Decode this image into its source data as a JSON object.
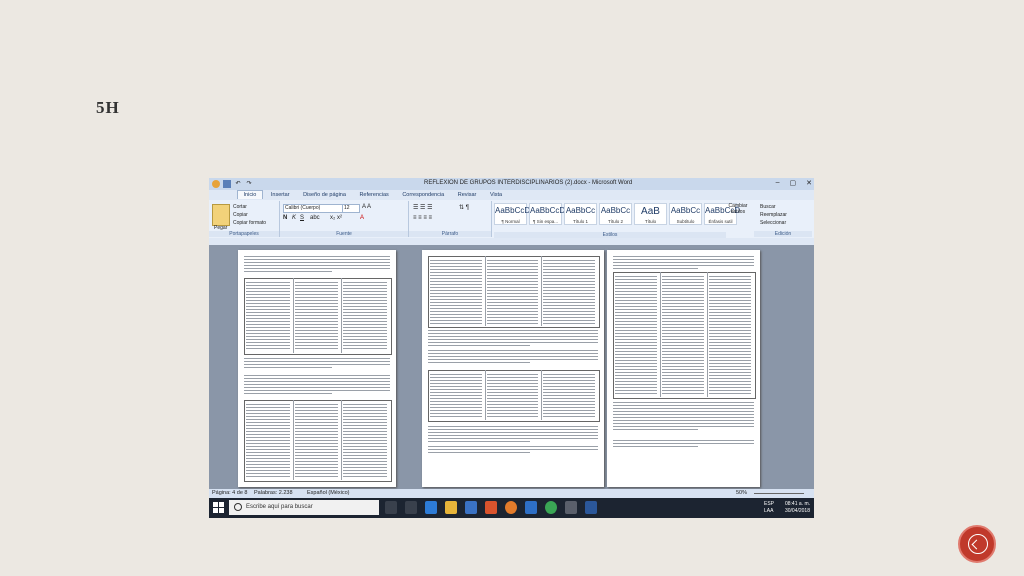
{
  "slide": {
    "title": "5H"
  },
  "window": {
    "title": "REFLEXION DE GRUPOS INTERDISCIPLINARIOS (2).docx - Microsoft Word",
    "min": "–",
    "max": "▢",
    "close": "✕"
  },
  "tabs": [
    "Inicio",
    "Insertar",
    "Diseño de página",
    "Referencias",
    "Correspondencia",
    "Revisar",
    "Vista"
  ],
  "ribbon": {
    "paste": "Pegar",
    "cut": "Cortar",
    "copy": "Copiar",
    "format_painter": "Copiar formato",
    "font_name": "Calibri (Cuerpo)",
    "font_size": "12",
    "clipboard_label": "Portapapeles",
    "font_label": "Fuente",
    "paragraph_label": "Párrafo",
    "styles_label": "Estilos",
    "editing_label": "Edición",
    "change_styles": "Cambiar estilos",
    "find": "Buscar",
    "replace": "Reemplazar",
    "select": "Seleccionar",
    "styles": [
      {
        "sample": "AaBbCcDc",
        "name": "¶ Normal"
      },
      {
        "sample": "AaBbCcDc",
        "name": "¶ Sin espa..."
      },
      {
        "sample": "AaBbCc",
        "name": "Título 1"
      },
      {
        "sample": "AaBbCc",
        "name": "Título 2"
      },
      {
        "sample": "AaB",
        "name": "Título"
      },
      {
        "sample": "AaBbCc",
        "name": "Subtítulo"
      },
      {
        "sample": "AaBbCcD",
        "name": "Énfasis sutil"
      }
    ]
  },
  "status": {
    "page": "Página: 4 de 8",
    "words": "Palabras: 2.238",
    "language": "Español (México)",
    "zoom": "50%"
  },
  "taskbar": {
    "search_placeholder": "Escribe aquí para buscar",
    "lang1": "ESP",
    "lang2": "LAA",
    "time": "08:41 a. m.",
    "date": "30/04/2018"
  }
}
